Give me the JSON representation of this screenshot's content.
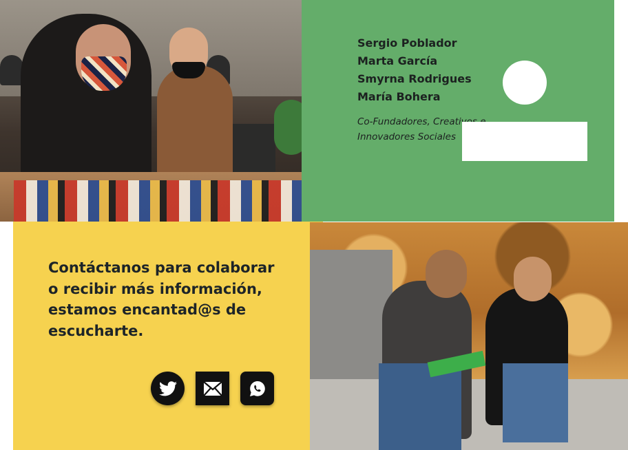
{
  "team": {
    "names": [
      "Sergio Poblador",
      "Marta García",
      "Smyrna Rodrigues",
      "María Bohera"
    ],
    "role": "Co-Fundadores, Creativos e Innovadores Sociales"
  },
  "contact": {
    "text": "Contáctanos para colaborar o recibir más información, estamos encantad@s de escucharte."
  },
  "social": {
    "buttons": [
      {
        "icon": "twitter-icon",
        "label": "Twitter"
      },
      {
        "icon": "email-icon",
        "label": "Email"
      },
      {
        "icon": "whatsapp-icon",
        "label": "WhatsApp"
      }
    ]
  },
  "colors": {
    "green_panel": "#64ad6a",
    "yellow_panel": "#f6d24f",
    "icon_bg": "#111111",
    "text_dark": "#1c2120"
  }
}
